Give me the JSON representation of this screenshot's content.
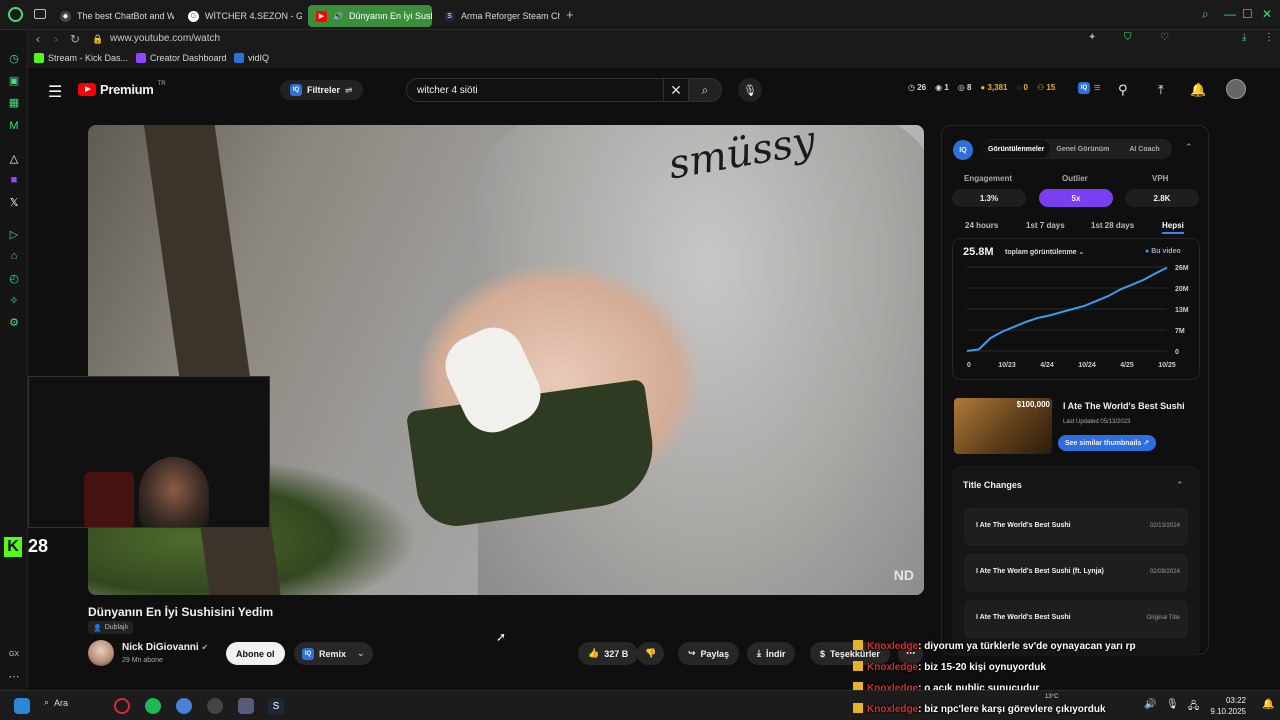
{
  "browser": {
    "tabs": [
      {
        "label": "The best ChatBot and Wi",
        "icon": "chatbot-icon"
      },
      {
        "label": "WİTCHER 4.SEZON - Go",
        "icon": "google-icon"
      },
      {
        "label": "Dünyanın En İyi Sushi",
        "icon": "youtube-icon"
      },
      {
        "label": "Arma Reforger Steam Cha",
        "icon": "steam-icon"
      }
    ],
    "url": "www.youtube.com/watch",
    "bookmarks": [
      "Stream - Kick Das...",
      "Creator Dashboard",
      "vidIQ"
    ]
  },
  "header": {
    "logo_text": "Premium",
    "logo_region": "TR",
    "filter_label": "Filtreler",
    "search_value": "witcher 4 siöti",
    "stats": [
      "26",
      "1",
      "8",
      "3,381",
      "0",
      "15"
    ]
  },
  "video": {
    "title": "Dünyanın En İyi Sushisini Yedim",
    "dubbed_label": "Dublajlı",
    "watermark": "ND",
    "channel": "Nick DiGiovanni",
    "subscribers": "29 Mn abone",
    "subscribe_label": "Abone ol",
    "remix_label": "Remix",
    "likes": "327 B",
    "share_label": "Paylaş",
    "download_label": "İndir",
    "thanks_label": "Teşekkürler"
  },
  "stream": {
    "kick_count": "28"
  },
  "vidiq": {
    "tabs": [
      "Görüntülenmeler",
      "Genel Görünüm",
      "AI Coach"
    ],
    "metrics": [
      {
        "label": "Engagement",
        "value": "1.3%"
      },
      {
        "label": "Outlier",
        "value": "5x"
      },
      {
        "label": "VPH",
        "value": "2.8K"
      }
    ],
    "ranges": [
      "24 hours",
      "1st 7 days",
      "1st 28 days",
      "Hepsi"
    ],
    "total_views": "25.8M",
    "views_label": "toplam görüntülenme",
    "legend_label": "Bu video",
    "thumb_badge": "$100,000",
    "similar_title": "I Ate The World's Best Sushi",
    "last_updated": "Last Updated 05/13/2023",
    "similar_button": "See similar thumbnails",
    "title_changes_heading": "Title Changes",
    "title_changes": [
      {
        "title": "I Ate The World's Best Sushi",
        "date": "02/13/2024"
      },
      {
        "title": "I Ate The World's Best Sushi (ft. Lynja)",
        "date": "02/09/2024"
      },
      {
        "title": "I Ate The World's Best Sushi",
        "date": "Original Title"
      }
    ]
  },
  "chart_data": {
    "type": "line",
    "x_ticks": [
      "0",
      "10/23",
      "4/24",
      "10/24",
      "4/25",
      "10/25"
    ],
    "y_ticks": [
      "26M",
      "20M",
      "13M",
      "7M",
      "0"
    ],
    "ylim": [
      0,
      26
    ],
    "series": [
      {
        "name": "Bu video",
        "color": "#3b9cf0",
        "values": [
          0,
          0.5,
          4,
          6,
          7.5,
          9,
          10.2,
          11,
          12,
          13,
          14,
          15.5,
          17,
          19,
          20.5,
          22,
          24,
          25.8
        ]
      }
    ]
  },
  "chat": [
    {
      "user": "Knoxledge",
      "msg": ": diyorum ya türklerle sv'de oynayacan yarı rp"
    },
    {
      "user": "Knoxledge",
      "msg": ": biz 15-20 kişi oynuyorduk"
    },
    {
      "user": "Knoxledge",
      "msg": ": o açık public sunucudur"
    },
    {
      "user": "Knoxledge",
      "msg": ": biz npc'lere karşı görevlere çıkıyorduk"
    }
  ],
  "taskbar": {
    "search_label": "Ara",
    "weather": "13°C",
    "time": "03:22",
    "date": "9.10.2025"
  },
  "colors": {
    "accent": "#3ee07a",
    "youtube_red": "#ff0000",
    "vidiq_purple": "#7b3ff2",
    "kick_green": "#53fc18"
  }
}
